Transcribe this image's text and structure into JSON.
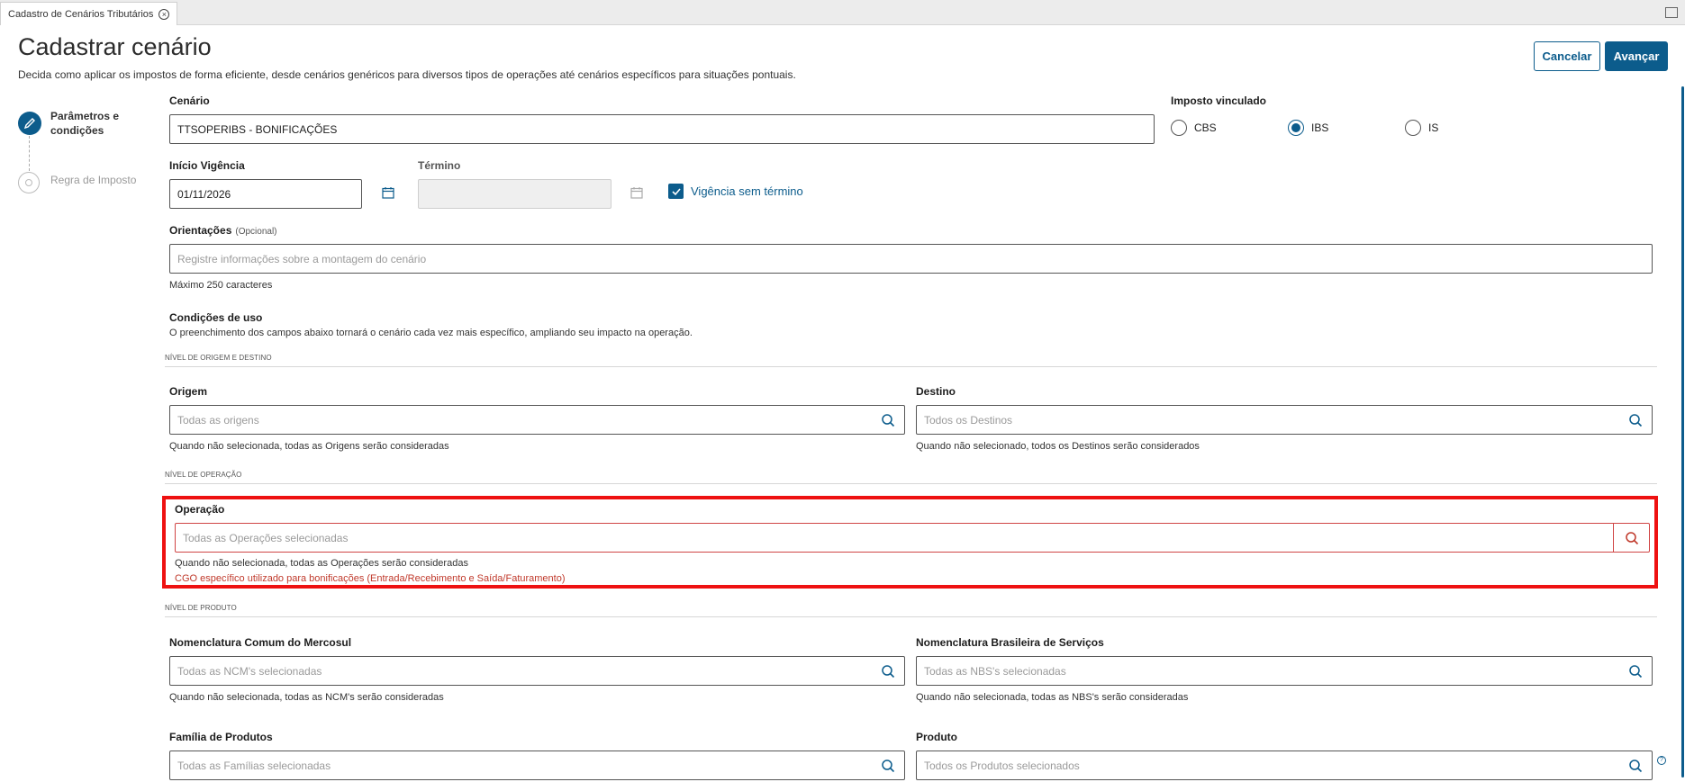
{
  "tab": {
    "label": "Cadastro de Cenários Tributários"
  },
  "header": {
    "title": "Cadastrar cenário",
    "subtitle": "Decida como aplicar os impostos de forma eficiente, desde cenários genéricos para diversos tipos de operações até cenários específicos para situações pontuais.",
    "cancel_label": "Cancelar",
    "next_label": "Avançar"
  },
  "stepper": {
    "steps": [
      {
        "label": "Parâmetros e condições",
        "state": "active",
        "icon": "pencil-icon"
      },
      {
        "label": "Regra de Imposto",
        "state": "pending",
        "icon": "circle-icon"
      }
    ]
  },
  "form": {
    "cenario": {
      "label": "Cenário",
      "value": "TTSOPERIBS - BONIFICAÇÕES"
    },
    "imposto": {
      "label": "Imposto vinculado",
      "options": [
        "CBS",
        "IBS",
        "IS"
      ],
      "selected": "IBS"
    },
    "inicio": {
      "label": "Início Vigência",
      "value": "01/11/2026"
    },
    "termino": {
      "label": "Término",
      "value": ""
    },
    "sem_termino": {
      "label": "Vigência sem término",
      "checked": true
    },
    "orientacoes": {
      "label": "Orientações",
      "optional": "(Opcional)",
      "placeholder": "Registre informações sobre a montagem do cenário",
      "help": "Máximo 250 caracteres"
    },
    "condicoes": {
      "title": "Condições de uso",
      "description": "O preenchimento dos campos abaixo tornará o cenário cada vez mais específico, ampliando seu impacto na operação."
    },
    "nivel_origem": "NÍVEL DE ORIGEM E DESTINO",
    "origem": {
      "label": "Origem",
      "placeholder": "Todas as origens",
      "help": "Quando não selecionada, todas as Origens serão consideradas"
    },
    "destino": {
      "label": "Destino",
      "placeholder": "Todos os Destinos",
      "help": "Quando não selecionado, todos os Destinos serão considerados"
    },
    "nivel_operacao": "NÍVEL DE OPERAÇÃO",
    "operacao": {
      "label": "Operação",
      "placeholder": "Todas as Operações selecionadas",
      "help": "Quando não selecionada, todas as Operações serão consideradas",
      "error": "CGO específico utilizado para bonificações (Entrada/Recebimento e Saída/Faturamento)"
    },
    "nivel_produto": "NÍVEL DE PRODUTO",
    "ncm": {
      "label": "Nomenclatura Comum do Mercosul",
      "placeholder": "Todas as NCM's selecionadas",
      "help": "Quando não selecionada, todas as NCM's serão consideradas"
    },
    "nbs": {
      "label": "Nomenclatura Brasileira de Serviços",
      "placeholder": "Todas as NBS's selecionadas",
      "help": "Quando não selecionada, todas as NBS's serão consideradas"
    },
    "familia": {
      "label": "Família de Produtos",
      "placeholder": "Todas as Famílias selecionadas"
    },
    "produto": {
      "label": "Produto",
      "placeholder": "Todos os Produtos selecionados"
    }
  },
  "colors": {
    "primary": "#0c5c8c",
    "highlight": "#ee1111",
    "error": "#c0392b"
  }
}
